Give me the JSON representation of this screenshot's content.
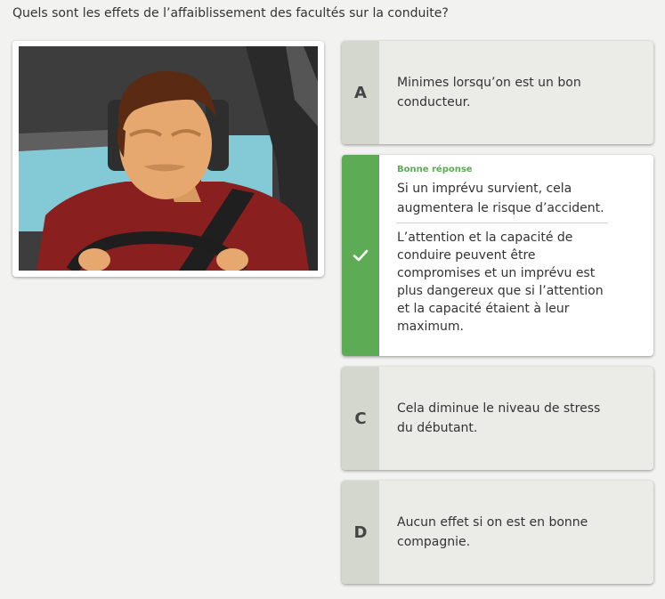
{
  "question": {
    "text": "Quels sont les effets de l’affaiblissement des facultés sur la conduite?"
  },
  "illustration": {
    "icon": "sleepy-driver-illustration",
    "colors": {
      "sky": "#84cad6",
      "interior": "#3d3d3d",
      "shirt": "#8a1f1f",
      "skin": "#e7a86f",
      "hair": "#5a2a13"
    }
  },
  "options": [
    {
      "letter": "A",
      "text": "Minimes lorsqu’on est un bon conducteur."
    },
    {
      "letter_icon": "checkmark-icon",
      "verdict": "Bonne réponse",
      "text": "Si un imprévu survient, cela augmentera le risque d’accident.",
      "explanation": "L’attention et la capacité de conduire peuvent être compromises et un imprévu est plus dangereux que si l’attention et la capacité étaient à leur maximum."
    },
    {
      "letter": "C",
      "text": "Cela diminue le niveau de stress du débutant."
    },
    {
      "letter": "D",
      "text": "Aucun effet si on est en bonne compagnie."
    }
  ],
  "colors": {
    "correct": "#5dab55",
    "option_bg": "#ebece7",
    "letter_bg": "#d4d7cd"
  }
}
